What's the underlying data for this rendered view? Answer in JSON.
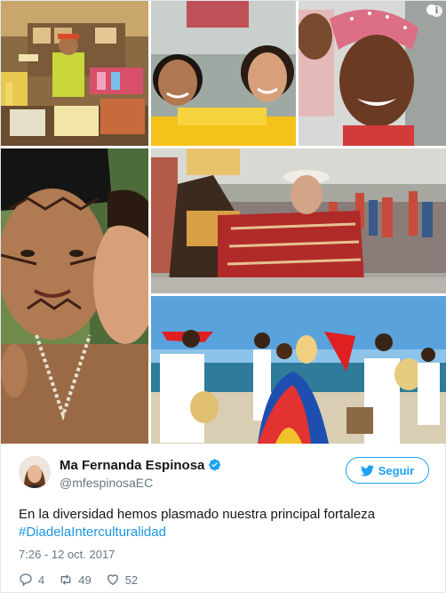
{
  "tweet": {
    "author_name": "Ma Fernanda Espinosa",
    "author_handle": "@mfespinosaEC",
    "follow_label": "Seguir",
    "text_line1": "En la diversidad hemos plasmado nuestra principal fortaleza",
    "hashtag": "#DiadelaInterculturalidad",
    "timestamp": "7:26 - 12 oct. 2017",
    "replies": "4",
    "retweets": "49",
    "likes": "52",
    "info_icon": "i"
  },
  "colors": {
    "accent": "#1da1f2",
    "hashtag": "#1b95e0",
    "muted": "#657786",
    "verified": "#1da1f2"
  },
  "icons": {
    "verified": "verified-badge-icon",
    "follow": "twitter-bird-icon",
    "reply": "reply-icon",
    "retweet": "retweet-icon",
    "like": "heart-icon",
    "info": "info-icon"
  }
}
